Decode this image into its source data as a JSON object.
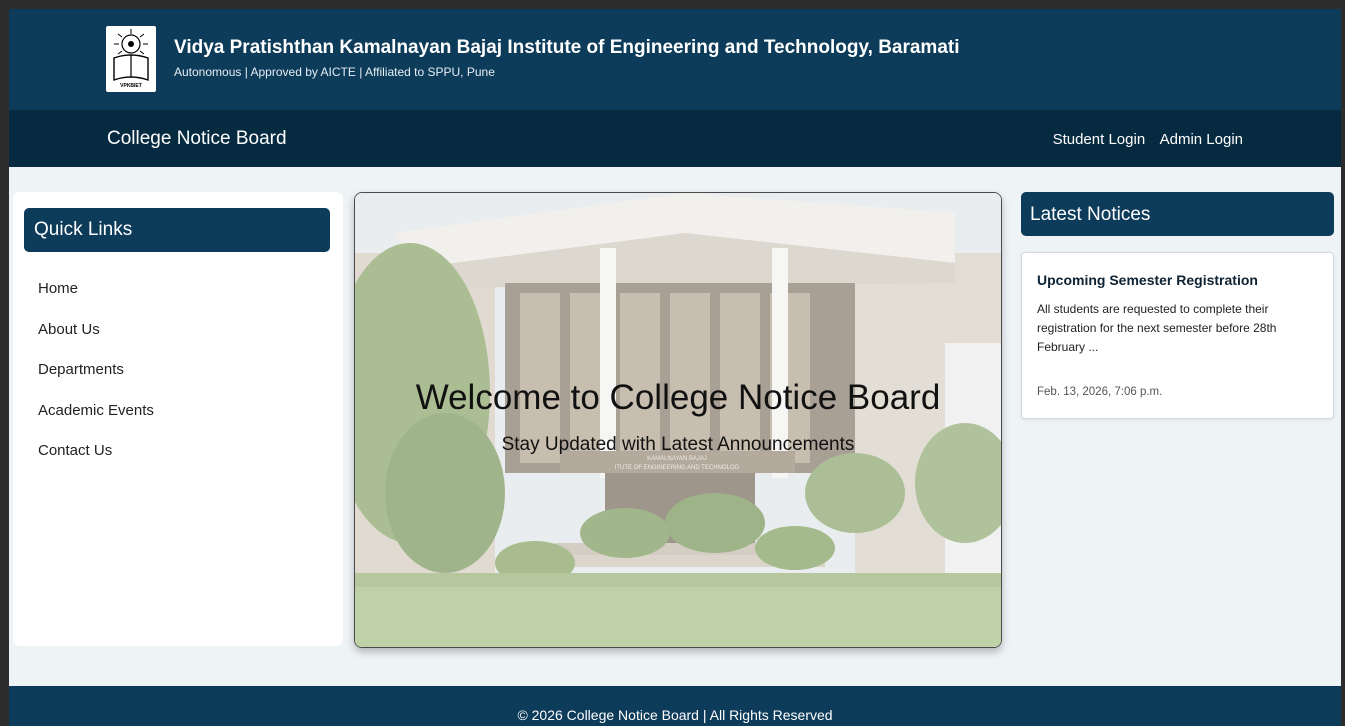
{
  "header": {
    "institute_name": "Vidya Pratishthan Kamalnayan Bajaj Institute of Engineering and Technology, Baramati",
    "subtitle": "Autonomous | Approved by AICTE | Affiliated to SPPU, Pune",
    "logo_text": "VPKBIET",
    "logo_icon": "college-emblem-icon"
  },
  "navbar": {
    "brand": "College Notice Board",
    "links": [
      "Student Login",
      "Admin Login"
    ]
  },
  "sidebar": {
    "title": "Quick Links",
    "items": [
      "Home",
      "About Us",
      "Departments",
      "Academic Events",
      "Contact Us"
    ]
  },
  "hero": {
    "title": "Welcome to College Notice Board",
    "subtitle": "Stay Updated with Latest Announcements",
    "building_sign_line1": "KAMALNAYAN BAJAJ",
    "building_sign_line2": "ITUTE OF ENGINEERING AND TECHNOLOG"
  },
  "notices": {
    "title": "Latest Notices",
    "items": [
      {
        "title": "Upcoming Semester Registration",
        "body": "All students are requested to complete their registration for the next semester before 28th February ...",
        "date": "Feb. 13, 2026, 7:06 p.m."
      }
    ]
  },
  "footer": {
    "text": "© 2026 College Notice Board | All Rights Reserved"
  },
  "colors": {
    "primary": "#0d3b5a",
    "navbar": "#062a40",
    "page_bg": "#eef3f5"
  }
}
